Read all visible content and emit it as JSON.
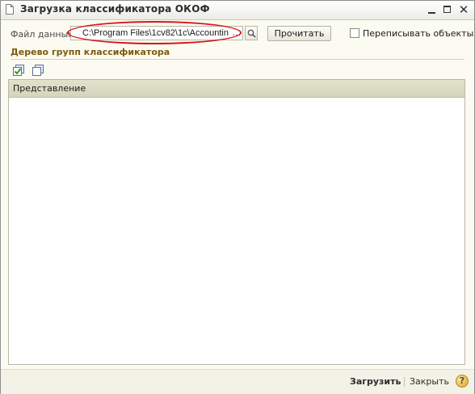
{
  "window": {
    "title": "Загрузка классификатора ОКОФ"
  },
  "file": {
    "label": "Файл данных:",
    "value": "C:\\Program Files\\1cv82\\1c\\Accountin",
    "ellipsis": "..."
  },
  "toolbar": {
    "read_label": "Прочитать",
    "overwrite_label": "Переписывать объекты",
    "overwrite_checked": false
  },
  "section": {
    "title": "Дерево групп классификатора"
  },
  "tree": {
    "columns": [
      "Представление"
    ],
    "rows": []
  },
  "footer": {
    "load_label": "Загрузить",
    "close_label": "Закрыть",
    "help_label": "?"
  },
  "colors": {
    "highlight": "#d8161b",
    "section_title": "#7d5b0c"
  }
}
